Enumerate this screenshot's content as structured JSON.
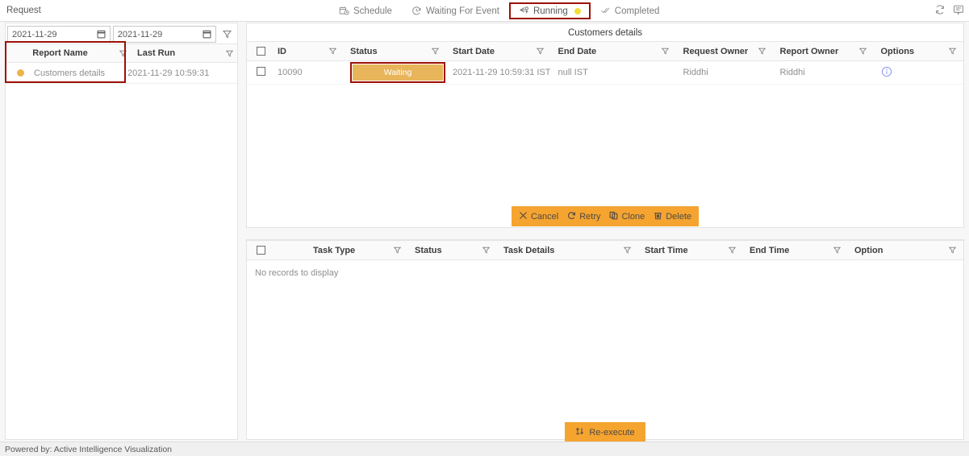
{
  "topbar": {
    "title": "Request",
    "tabs": [
      {
        "label": "Schedule",
        "icon": "calendar-clock-icon",
        "active": false
      },
      {
        "label": "Waiting For Event",
        "icon": "clock-icon",
        "active": false
      },
      {
        "label": "Running",
        "icon": "running-arrow-icon",
        "active": true,
        "dot": "yellow"
      },
      {
        "label": "Completed",
        "icon": "double-check-icon",
        "active": false
      }
    ],
    "right_icons": [
      {
        "name": "refresh-icon"
      },
      {
        "name": "comment-icon"
      }
    ]
  },
  "left_panel": {
    "date_from": {
      "value": "2021-11-29",
      "placeholder": "yyyy-mm-dd"
    },
    "date_to": {
      "value": "2021-11-29",
      "placeholder": "yyyy-mm-dd"
    },
    "filter_icon": "filter-funnel-icon",
    "columns": [
      "Report Name",
      "Last Run"
    ],
    "rows": [
      {
        "status_color": "#edb44b",
        "report_name": "Customers details",
        "last_run": "2021-11-29 10:59:31"
      }
    ]
  },
  "requests_panel": {
    "title": "Customers details",
    "columns": [
      "ID",
      "Status",
      "Start Date",
      "End Date",
      "Request Owner",
      "Report Owner",
      "Options"
    ],
    "rows": [
      {
        "id": "10090",
        "status": "Waiting",
        "start_date": "2021-11-29 10:59:31 IST",
        "end_date": "null IST",
        "request_owner": "Riddhi",
        "report_owner": "Riddhi",
        "options_icon": "info-circle-icon"
      }
    ],
    "actions": [
      {
        "label": "Cancel",
        "icon": "close-x-icon"
      },
      {
        "label": "Retry",
        "icon": "refresh-cw-icon"
      },
      {
        "label": "Clone",
        "icon": "copy-icon"
      },
      {
        "label": "Delete",
        "icon": "trash-icon"
      }
    ]
  },
  "tasks_panel": {
    "columns": [
      "Task Type",
      "Status",
      "Task Details",
      "Start Time",
      "End Time",
      "Option"
    ],
    "empty_message": "No records to display",
    "reexecute": {
      "label": "Re-execute",
      "icon": "reexecute-arrows-icon"
    }
  },
  "footer": {
    "text": "Powered by: Active Intelligence Visualization"
  },
  "colors": {
    "accent_orange": "#f5a430",
    "badge_orange": "#e8b55a",
    "highlight_red": "#9c1006",
    "status_dot": "#edb44b",
    "tab_dot_yellow": "#f2dd3a",
    "info_blue": "#7b86e8"
  }
}
